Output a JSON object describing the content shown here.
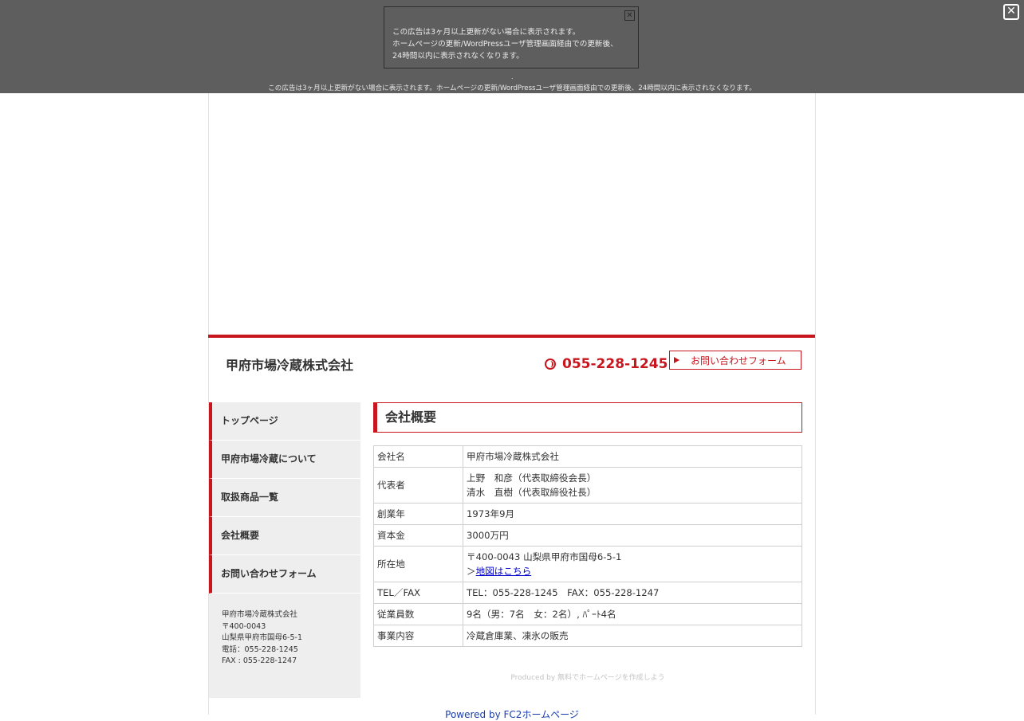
{
  "overlay": {
    "ad_lines": [
      "この広告は3ヶ月以上更新がない場合に表示されます。",
      "ホームページの更新/WordPressユーザ管理画面経由での更新後、",
      "24時間以内に表示されなくなります。"
    ],
    "ad_close": "✕",
    "dot": ".",
    "bottom_text": "この広告は3ヶ月以上更新がない場合に表示されます。ホームページの更新/WordPressユーザ管理画面経由での更新後、24時間以内に表示されなくなります。",
    "close_glyph": "✕"
  },
  "header": {
    "site_title": "甲府市場冷蔵株式会社",
    "phone": "055-228-1245",
    "contact_button": "お問い合わせフォーム"
  },
  "sidebar": {
    "items": [
      {
        "label": "トップページ"
      },
      {
        "label": "甲府市場冷蔵について"
      },
      {
        "label": "取扱商品一覧"
      },
      {
        "label": "会社概要"
      },
      {
        "label": "お問い合わせフォーム"
      }
    ],
    "address": [
      "甲府市場冷蔵株式会社",
      "〒400-0043",
      "山梨県甲府市国母6-5-1",
      "電話：055-228-1245",
      "FAX : 055-228-1247"
    ]
  },
  "main": {
    "title": "会社概要",
    "rows": [
      {
        "label": "会社名",
        "lines": [
          "甲府市場冷蔵株式会社"
        ]
      },
      {
        "label": "代表者",
        "lines": [
          "上野　和彦（代表取締役会長）",
          "清水　直樹（代表取締役社長）"
        ]
      },
      {
        "label": "創業年",
        "lines": [
          "1973年9月"
        ]
      },
      {
        "label": "資本金",
        "lines": [
          "3000万円"
        ]
      },
      {
        "label": "所在地",
        "lines": [
          "〒400-0043 山梨県甲府市国母6-5-1"
        ],
        "link_prefix": "＞",
        "link_text": "地図はこちら"
      },
      {
        "label": "TEL／FAX",
        "lines": [
          "TEL：055-228-1245　FAX：055-228-1247"
        ]
      },
      {
        "label": "従業員数",
        "lines": [
          "9名（男：7名　女：2名）, ﾊﾟｰﾄ4名"
        ]
      },
      {
        "label": "事業内容",
        "lines": [
          "冷蔵倉庫業、凍氷の販売"
        ]
      }
    ]
  },
  "footer": {
    "produced": "Produced by 無料でホームページを作成しよう",
    "powered": "Powered by FC2ホームページ"
  }
}
